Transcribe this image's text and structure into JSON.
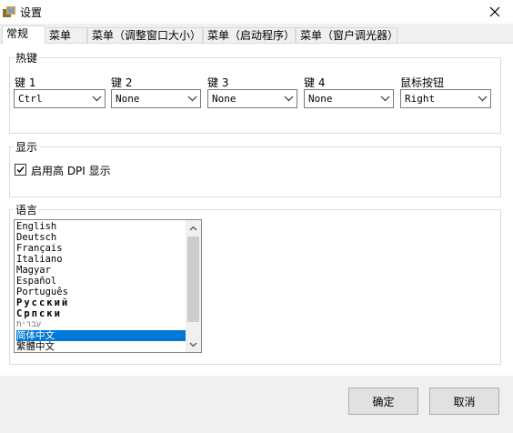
{
  "window": {
    "title": "设置",
    "app_icon": "settings-app-icon",
    "close_icon": "close-icon"
  },
  "tabs": [
    {
      "label": "常规",
      "active": true
    },
    {
      "label": "菜单"
    },
    {
      "label": "菜单（调整窗口大小）"
    },
    {
      "label": "菜单（启动程序）"
    },
    {
      "label": "菜单（窗户调光器）"
    }
  ],
  "hotkeys": {
    "group_label": "热键",
    "fields": [
      {
        "label": "键 1",
        "value": "Ctrl"
      },
      {
        "label": "键 2",
        "value": "None"
      },
      {
        "label": "键 3",
        "value": "None"
      },
      {
        "label": "键 4",
        "value": "None"
      },
      {
        "label": "鼠标按钮",
        "value": "Right"
      }
    ]
  },
  "display": {
    "group_label": "显示",
    "high_dpi_label": "启用高 DPI 显示",
    "high_dpi_checked": true
  },
  "language": {
    "group_label": "语言",
    "items": [
      "English",
      "Deutsch",
      "Français",
      "Italiano",
      "Magyar",
      "Español",
      "Português",
      "Русский",
      "Српски",
      "עברית",
      "简体中文",
      "繁體中文"
    ],
    "selected": "简体中文"
  },
  "buttons": {
    "ok": "确定",
    "cancel": "取消"
  }
}
